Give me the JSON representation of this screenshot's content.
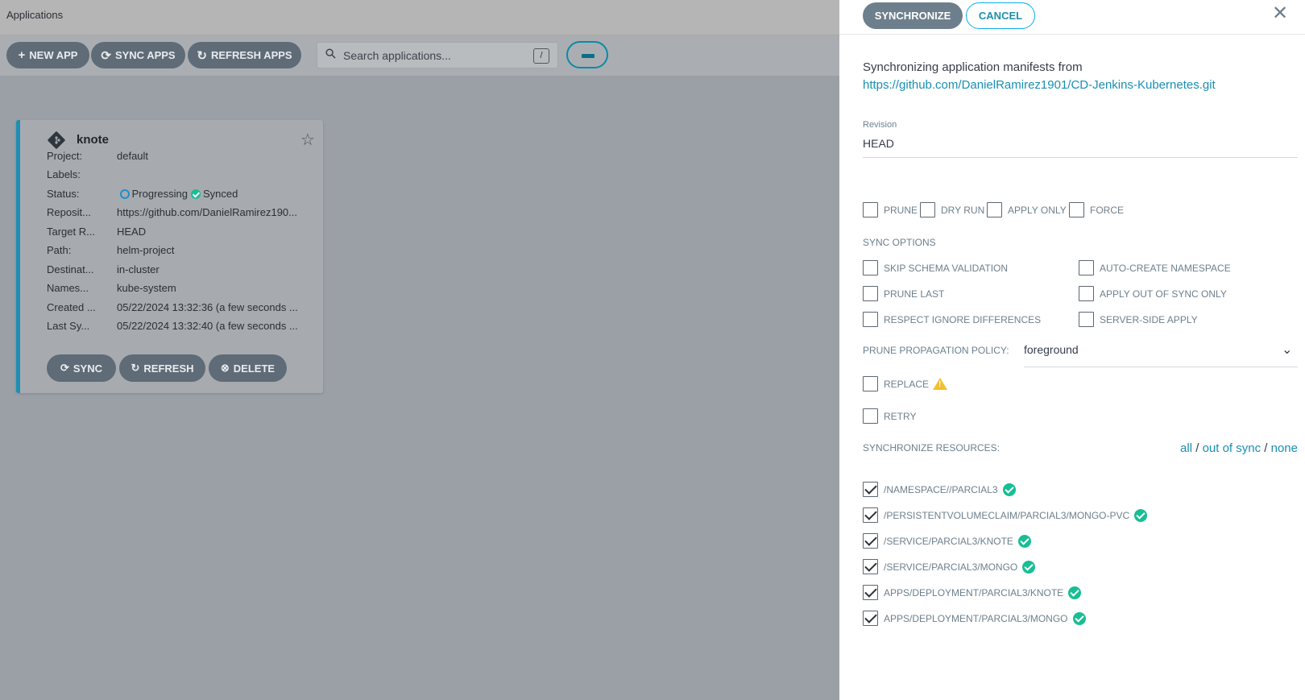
{
  "app": {
    "title": "Applications"
  },
  "toolbar": {
    "new_app": "NEW APP",
    "sync_apps": "SYNC APPS",
    "refresh_apps": "REFRESH APPS",
    "search_placeholder": "Search applications...",
    "search_shortcut": "/"
  },
  "card": {
    "name": "knote",
    "rows": {
      "project": {
        "label": "Project:",
        "value": "default"
      },
      "labels": {
        "label": "Labels:",
        "value": ""
      },
      "status": {
        "label": "Status:",
        "health": "Progressing",
        "sync": "Synced"
      },
      "repo": {
        "label": "Reposit...",
        "value": "https://github.com/DanielRamirez190..."
      },
      "target": {
        "label": "Target R...",
        "value": "HEAD"
      },
      "path": {
        "label": "Path:",
        "value": "helm-project"
      },
      "dest": {
        "label": "Destinat...",
        "value": "in-cluster"
      },
      "ns": {
        "label": "Names...",
        "value": "kube-system"
      },
      "created": {
        "label": "Created ...",
        "value": "05/22/2024 13:32:36  (a few seconds ..."
      },
      "lastsync": {
        "label": "Last Sy...",
        "value": "05/22/2024 13:32:40  (a few seconds ..."
      }
    },
    "buttons": {
      "sync": "SYNC",
      "refresh": "REFRESH",
      "delete": "DELETE"
    }
  },
  "panel": {
    "synchronize": "SYNCHRONIZE",
    "cancel": "CANCEL",
    "intro": "Synchronizing application manifests from",
    "repo_url": "https://github.com/DanielRamirez1901/CD-Jenkins-Kubernetes.git",
    "revision_label": "Revision",
    "revision_value": "HEAD",
    "options": {
      "prune": "PRUNE",
      "dry_run": "DRY RUN",
      "apply_only": "APPLY ONLY",
      "force": "FORCE"
    },
    "sync_options_title": "SYNC OPTIONS",
    "sync_options": {
      "skip_schema": "SKIP SCHEMA VALIDATION",
      "auto_ns": "AUTO-CREATE NAMESPACE",
      "prune_last": "PRUNE LAST",
      "apply_oos": "APPLY OUT OF SYNC ONLY",
      "respect_ignore": "RESPECT IGNORE DIFFERENCES",
      "server_side": "SERVER-SIDE APPLY"
    },
    "prune_policy_label": "PRUNE PROPAGATION POLICY:",
    "prune_policy_value": "foreground",
    "replace": "REPLACE",
    "retry": "RETRY",
    "resources_title": "SYNCHRONIZE RESOURCES:",
    "select": {
      "all": "all",
      "sep1": "/",
      "out_of_sync": "out of sync",
      "sep2": "/",
      "none": "none"
    },
    "resources": [
      "/NAMESPACE//PARCIAL3",
      "/PERSISTENTVOLUMECLAIM/PARCIAL3/MONGO-PVC",
      "/SERVICE/PARCIAL3/KNOTE",
      "/SERVICE/PARCIAL3/MONGO",
      "APPS/DEPLOYMENT/PARCIAL3/KNOTE",
      "APPS/DEPLOYMENT/PARCIAL3/MONGO"
    ]
  }
}
